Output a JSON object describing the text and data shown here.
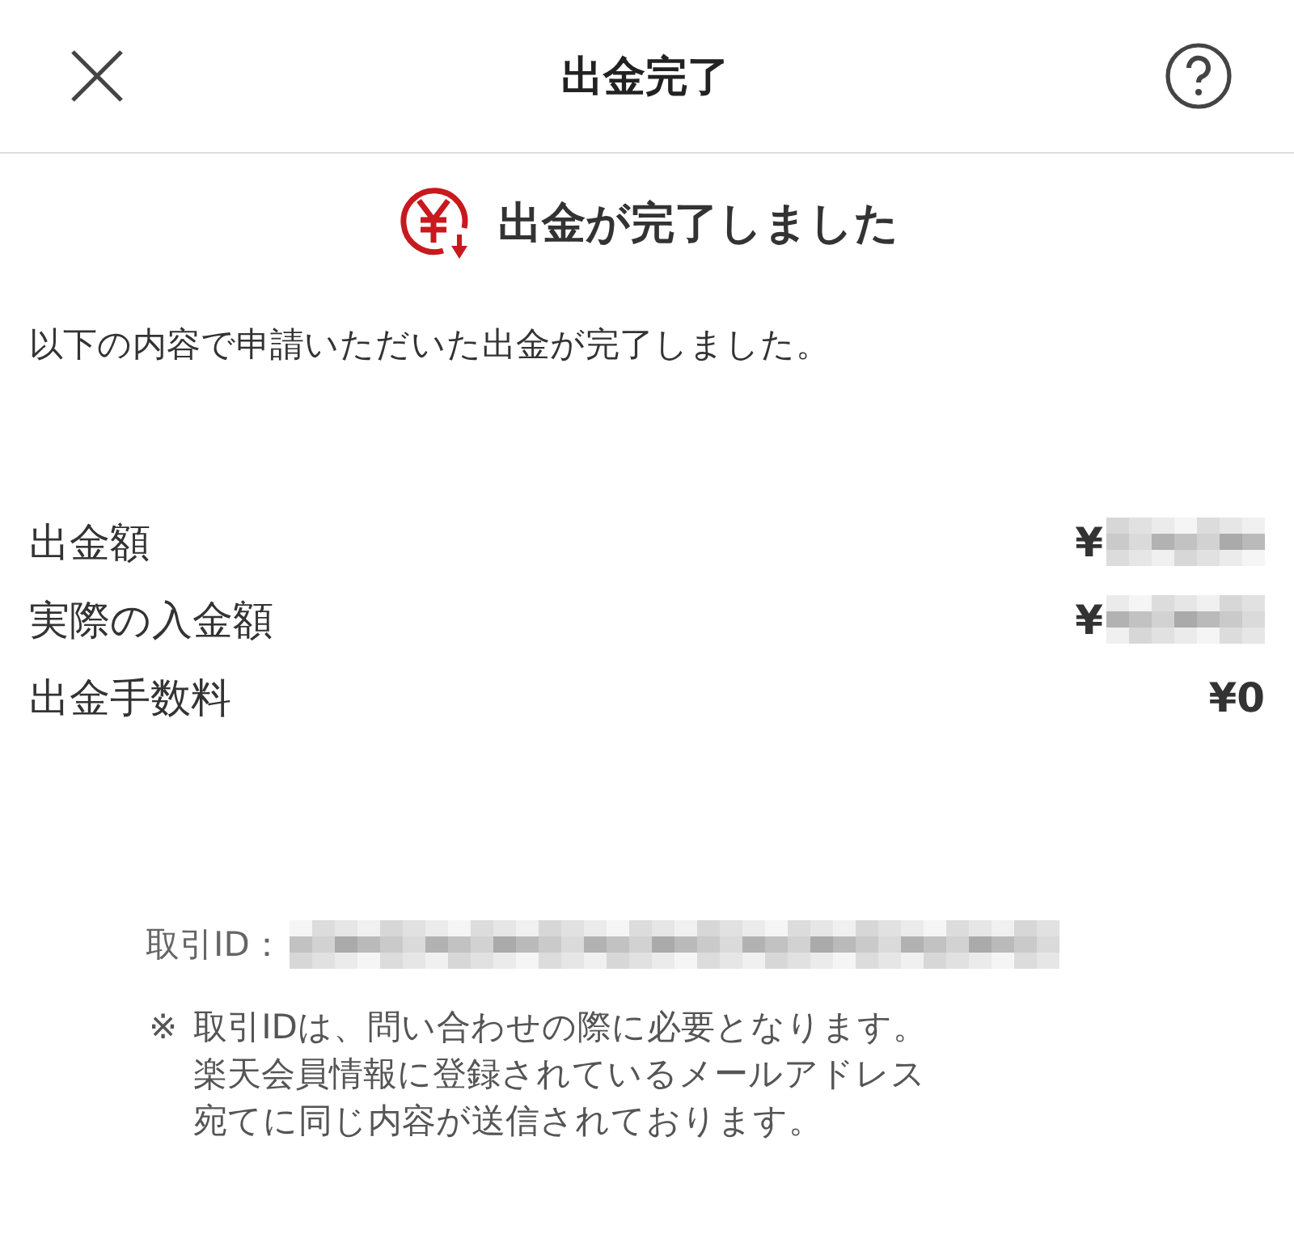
{
  "header": {
    "title": "出金完了"
  },
  "status": {
    "title": "出金が完了しました"
  },
  "message": "以下の内容で申請いただいた出金が完了しました。",
  "rows": [
    {
      "label": "出金額",
      "value": "¥",
      "redacted": true
    },
    {
      "label": "実際の入金額",
      "value": "¥",
      "redacted": true
    },
    {
      "label": "出金手数料",
      "value": "¥0",
      "redacted": false
    }
  ],
  "transaction": {
    "label": "取引ID：",
    "redacted": true
  },
  "note": {
    "mark": "※",
    "lines": [
      "取引IDは、問い合わせの際に必要となります。",
      "楽天会員情報に登録されているメールアドレス",
      "宛てに同じ内容が送信されております。"
    ]
  }
}
